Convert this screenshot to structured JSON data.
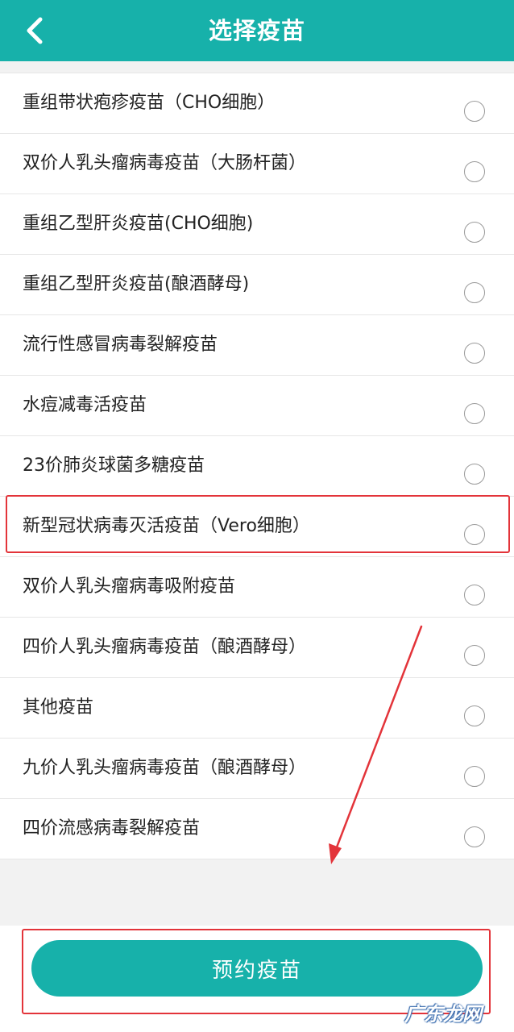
{
  "header": {
    "title": "选择疫苗",
    "back_icon": "chevron-left-icon",
    "background_color": "#17b1aa"
  },
  "vaccines": [
    {
      "label": "重组带状疱疹疫苗（CHO细胞）"
    },
    {
      "label": "双价人乳头瘤病毒疫苗（大肠杆菌）"
    },
    {
      "label": "重组乙型肝炎疫苗(CHO细胞)"
    },
    {
      "label": "重组乙型肝炎疫苗(酿酒酵母)"
    },
    {
      "label": "流行性感冒病毒裂解疫苗"
    },
    {
      "label": "水痘减毒活疫苗"
    },
    {
      "label": "23价肺炎球菌多糖疫苗"
    },
    {
      "label": "新型冠状病毒灭活疫苗（Vero细胞）"
    },
    {
      "label": "双价人乳头瘤病毒吸附疫苗"
    },
    {
      "label": "四价人乳头瘤病毒疫苗（酿酒酵母）"
    },
    {
      "label": "其他疫苗"
    },
    {
      "label": "九价人乳头瘤病毒疫苗（酿酒酵母）"
    },
    {
      "label": "四价流感病毒裂解疫苗"
    }
  ],
  "actions": {
    "book_label": "预约疫苗"
  },
  "watermark": {
    "text": "广东龙网"
  },
  "colors": {
    "accent": "#17b1aa",
    "annotation": "#e3343a"
  }
}
